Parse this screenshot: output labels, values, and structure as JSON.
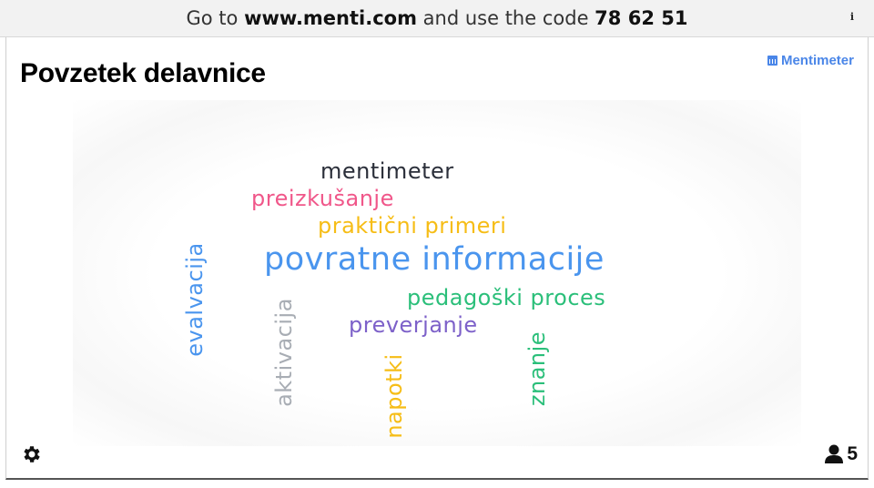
{
  "header": {
    "prefix": "Go to",
    "url": "www.menti.com",
    "middle": "and use the code",
    "code": "78 62 51",
    "info_icon": "i"
  },
  "slide": {
    "title": "Povzetek delavnice",
    "brand": "Mentimeter"
  },
  "word_cloud": {
    "words": [
      {
        "text": "mentimeter",
        "color": "#2b2f3a"
      },
      {
        "text": "preizkušanje",
        "color": "#f0578a"
      },
      {
        "text": "praktični primeri",
        "color": "#f6bd16"
      },
      {
        "text": "povratne informacije",
        "color": "#4a95ee"
      },
      {
        "text": "pedagoški proces",
        "color": "#2bbf7a"
      },
      {
        "text": "preverjanje",
        "color": "#7d61c9"
      },
      {
        "text": "evalvacija",
        "color": "#4a95ee"
      },
      {
        "text": "aktivacija",
        "color": "#a8adb4"
      },
      {
        "text": "napotki",
        "color": "#f6bd16"
      },
      {
        "text": "znanje",
        "color": "#2bbf7a"
      }
    ]
  },
  "footer": {
    "settings_icon": "gear-icon",
    "participant_icon": "user-icon",
    "participant_count": "5"
  }
}
